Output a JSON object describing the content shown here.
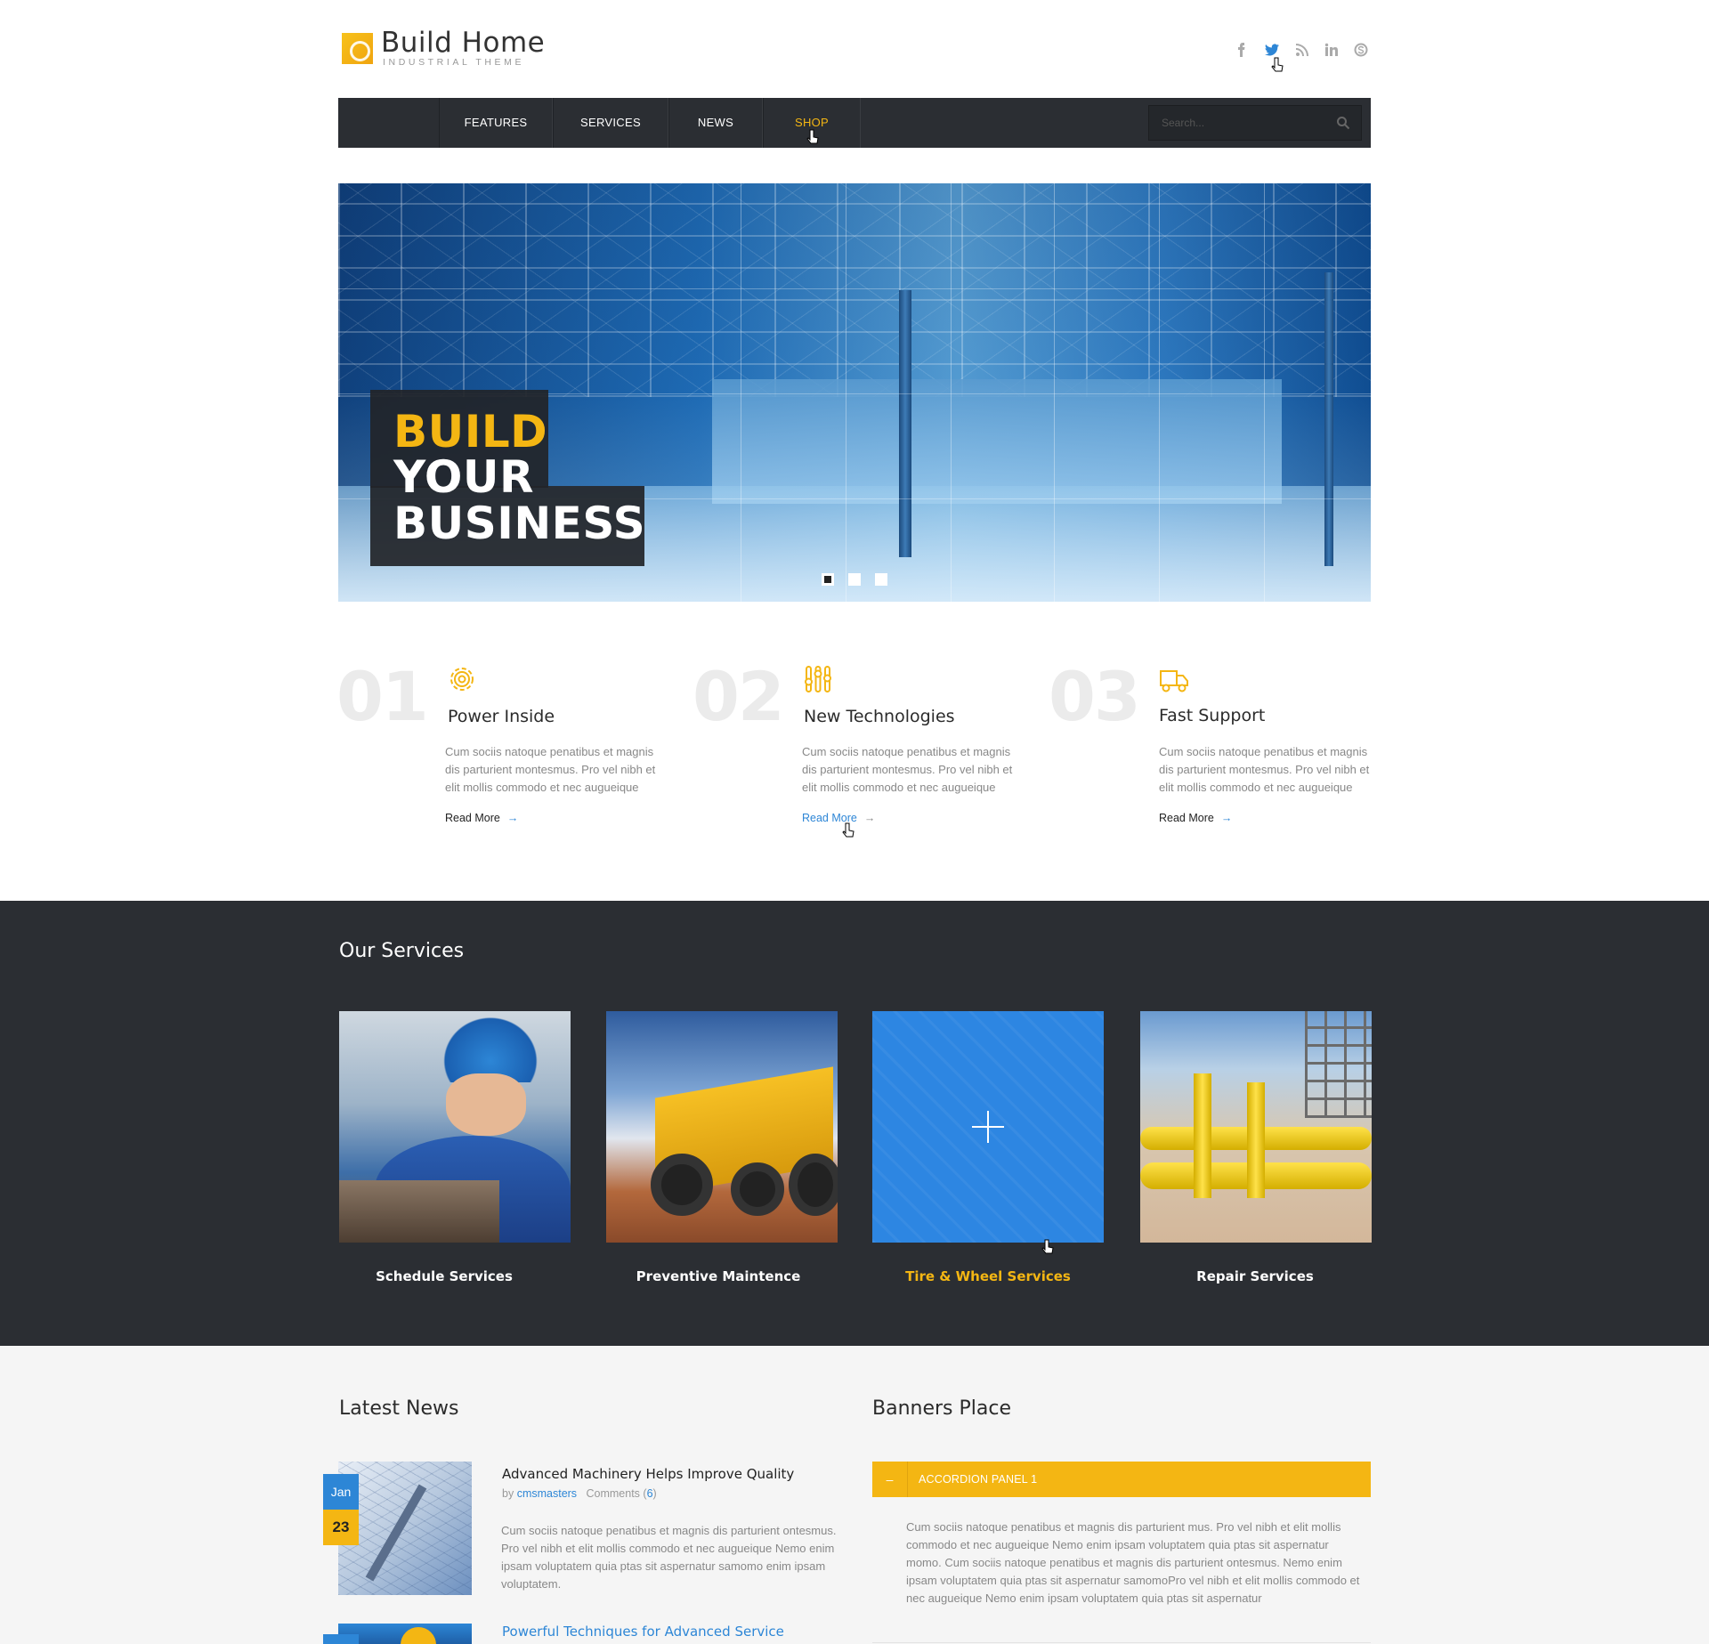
{
  "header": {
    "logo_title": "Build Home",
    "logo_subtitle": "INDUSTRIAL THEME",
    "social": [
      "facebook-icon",
      "twitter-icon",
      "rss-icon",
      "linkedin-icon",
      "skype-icon"
    ]
  },
  "nav": {
    "items": [
      "FEATURES",
      "SERVICES",
      "NEWS",
      "SHOP"
    ],
    "active": "SHOP",
    "search_placeholder": "Search..."
  },
  "hero": {
    "line1": "BUILD",
    "line2": "YOUR",
    "line3": "BUSINESS",
    "slides": 3,
    "active_slide": 1
  },
  "features": [
    {
      "num": "01",
      "title": "Power Inside",
      "text": "Cum sociis natoque penatibus et magnis dis parturient montesmus. Pro vel nibh et elit mollis commodo et nec augueique",
      "link": "Read More",
      "icon": "gear-icon"
    },
    {
      "num": "02",
      "title": "New Technologies",
      "text": "Cum sociis natoque penatibus et magnis dis parturient montesmus. Pro vel nibh et elit mollis commodo et nec augueique",
      "link": "Read More",
      "icon": "sliders-icon"
    },
    {
      "num": "03",
      "title": "Fast Support",
      "text": "Cum sociis natoque penatibus et magnis dis parturient montesmus. Pro vel nibh et elit mollis commodo et nec augueique",
      "link": "Read More",
      "icon": "truck-icon"
    }
  ],
  "services": {
    "title": "Our Services",
    "items": [
      {
        "label": "Schedule Services"
      },
      {
        "label": "Preventive Maintence"
      },
      {
        "label": "Tire & Wheel Services"
      },
      {
        "label": "Repair Services"
      }
    ]
  },
  "news": {
    "title": "Latest News",
    "items": [
      {
        "month": "Jan",
        "day": "23",
        "title": "Advanced Machinery Helps Improve Quality",
        "by": "by",
        "author": "cmsmasters",
        "comments_label": "Comments",
        "comments_count": "6",
        "text": "Cum sociis natoque penatibus et magnis dis parturient ontesmus. Pro vel nibh et elit mollis commodo et nec augueique Nemo enim ipsam voluptatem quia ptas sit aspernatur samomo enim ipsam voluptatem."
      },
      {
        "title": "Powerful Techniques for Advanced Service"
      }
    ]
  },
  "banners": {
    "title": "Banners Place",
    "accordion_label": "ACCORDION PANEL 1",
    "accordion_text": "Cum sociis natoque penatibus et magnis dis parturient mus. Pro vel nibh et elit mollis commodo et nec augueique Nemo enim ipsam voluptatem quia ptas sit aspernatur momo. Cum sociis natoque penatibus et magnis dis parturient ontesmus. Nemo enim ipsam voluptatem quia ptas sit aspernatur samomoPro vel nibh et elit mollis commodo et nec augueique Nemo enim ipsam voluptatem quia ptas sit aspernatur"
  },
  "colors": {
    "accent_yellow": "#f4b613",
    "accent_blue": "#2d86d6",
    "dark": "#2b2e33"
  }
}
